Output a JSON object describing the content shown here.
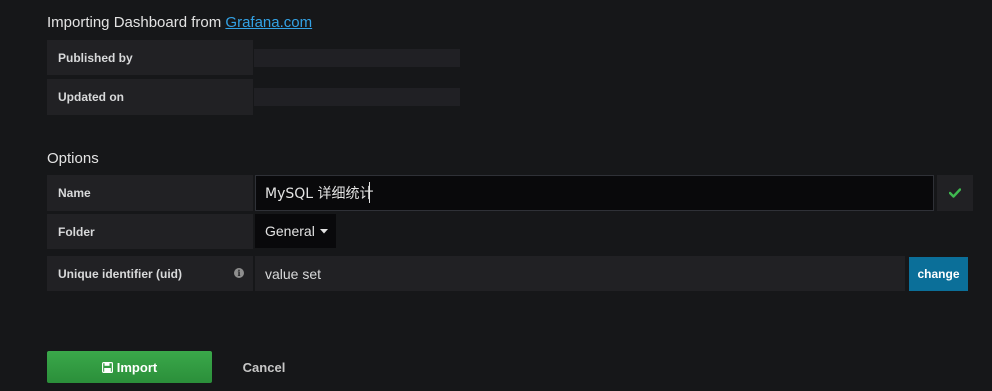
{
  "header": {
    "title_prefix": "Importing Dashboard from",
    "title_link": "Grafana.com"
  },
  "info_rows": [
    {
      "label": "Published by",
      "value": ""
    },
    {
      "label": "Updated on",
      "value": ""
    }
  ],
  "options": {
    "section_title": "Options",
    "name": {
      "label": "Name",
      "value": "MySQL 详细统计",
      "valid": true,
      "valid_icon": "check-icon"
    },
    "folder": {
      "label": "Folder",
      "selected": "General"
    },
    "uid": {
      "label": "Unique identifier (uid)",
      "value": "value set",
      "change_label": "change"
    }
  },
  "actions": {
    "import_label": "Import",
    "cancel_label": "Cancel"
  },
  "colors": {
    "background": "#161719",
    "link": "#33a2e5",
    "valid": "#3fb950",
    "primary": "#0b6f99",
    "success": "#2b8f3a"
  }
}
